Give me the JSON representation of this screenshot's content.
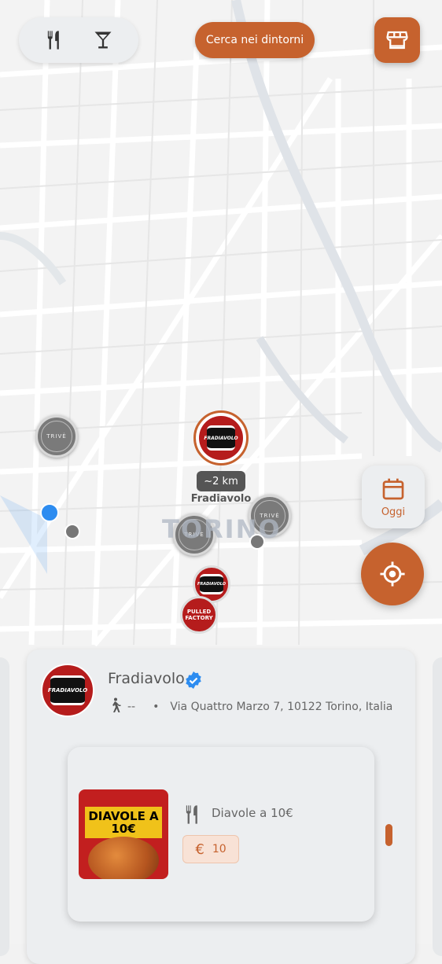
{
  "toolbar": {
    "filter_icons": [
      "fork-knife-icon",
      "cocktail-icon"
    ],
    "search_label": "Cerca nei dintorni",
    "store_icon": "store-icon"
  },
  "map": {
    "city_label": "TORINO",
    "selected_marker": {
      "distance": "~2 km",
      "name": "Fradiavolo",
      "logo_text": "FRADIAVOLO"
    },
    "markers": [
      "TRIVÈ",
      "TRIVÈ",
      "TRIVÈ",
      "FRADIAVOLO",
      "PULLED FACTORY"
    ]
  },
  "controls": {
    "date_label": "Oggi",
    "date_icon": "calendar-icon",
    "locate_icon": "crosshair-icon"
  },
  "venue_card": {
    "name": "Fradiavolo",
    "verified_icon": "verified-badge-icon",
    "walk_time": "--",
    "separator": "•",
    "address": "Via Quattro Marzo 7, 10122 Torino, Italia",
    "offer": {
      "poster_title": "DIAVOLE A 10€",
      "title": "Diavole a 10€",
      "currency": "€",
      "price": "10"
    }
  },
  "colors": {
    "accent": "#c6622e",
    "brand_red": "#b51c1c",
    "user_location": "#2d8cf0"
  }
}
